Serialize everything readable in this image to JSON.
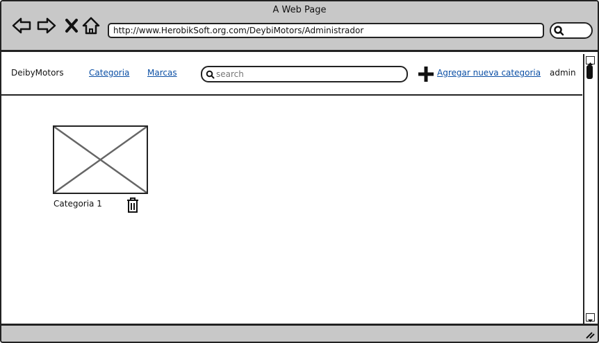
{
  "browser": {
    "title": "A Web Page",
    "url": "http://www.HerobikSoft.org.com/DeybiMotors/Administrador",
    "icons": [
      "back-icon",
      "forward-icon",
      "close-icon",
      "home-icon",
      "search-icon"
    ]
  },
  "navbar": {
    "brand": "DeibyMotors",
    "links": [
      {
        "label": "Categoria"
      },
      {
        "label": "Marcas"
      }
    ],
    "search": {
      "placeholder": "search",
      "value": ""
    },
    "add_label": "Agregar nueva categoria",
    "user": "admin"
  },
  "categories": [
    {
      "name": "Categoria 1",
      "image": "placeholder-image",
      "action_icon": "trash-icon"
    }
  ],
  "colors": {
    "chrome": "#c8c8c8",
    "link": "#0b4fa5",
    "border": "#222222"
  }
}
